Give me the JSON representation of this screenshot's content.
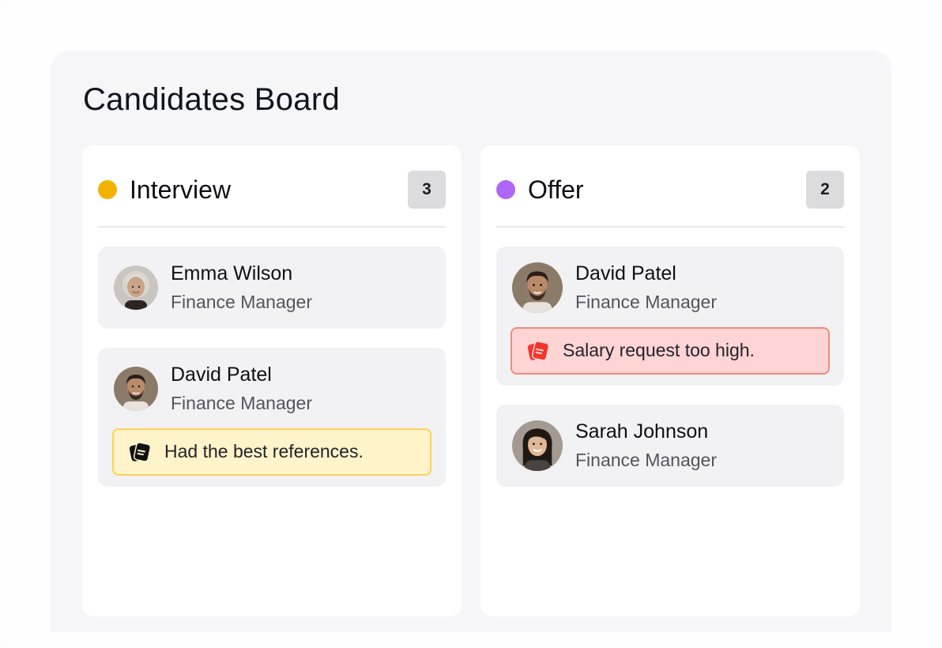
{
  "board": {
    "title": "Candidates Board",
    "columns": [
      {
        "title": "Interview",
        "count": "3",
        "dot_color": "#f2b300",
        "cards": [
          {
            "name": "Emma Wilson",
            "role": "Finance Manager",
            "avatar": "elderly-woman-avatar"
          },
          {
            "name": "David Patel",
            "role": "Finance Manager",
            "avatar": "bearded-man-avatar",
            "note": {
              "text": "Had the best references.",
              "icon": "comment-icon",
              "color": "#fbd25a"
            }
          }
        ]
      },
      {
        "title": "Offer",
        "count": "2",
        "dot_color": "#b066f5",
        "cards": [
          {
            "name": "David Patel",
            "role": "Finance Manager",
            "avatar": "bearded-man-avatar",
            "note": {
              "text": "Salary request too high.",
              "icon": "comment-icon",
              "color": "#f0362a"
            }
          },
          {
            "name": "Sarah Johnson",
            "role": "Finance Manager",
            "avatar": "woman-avatar"
          }
        ]
      }
    ]
  }
}
